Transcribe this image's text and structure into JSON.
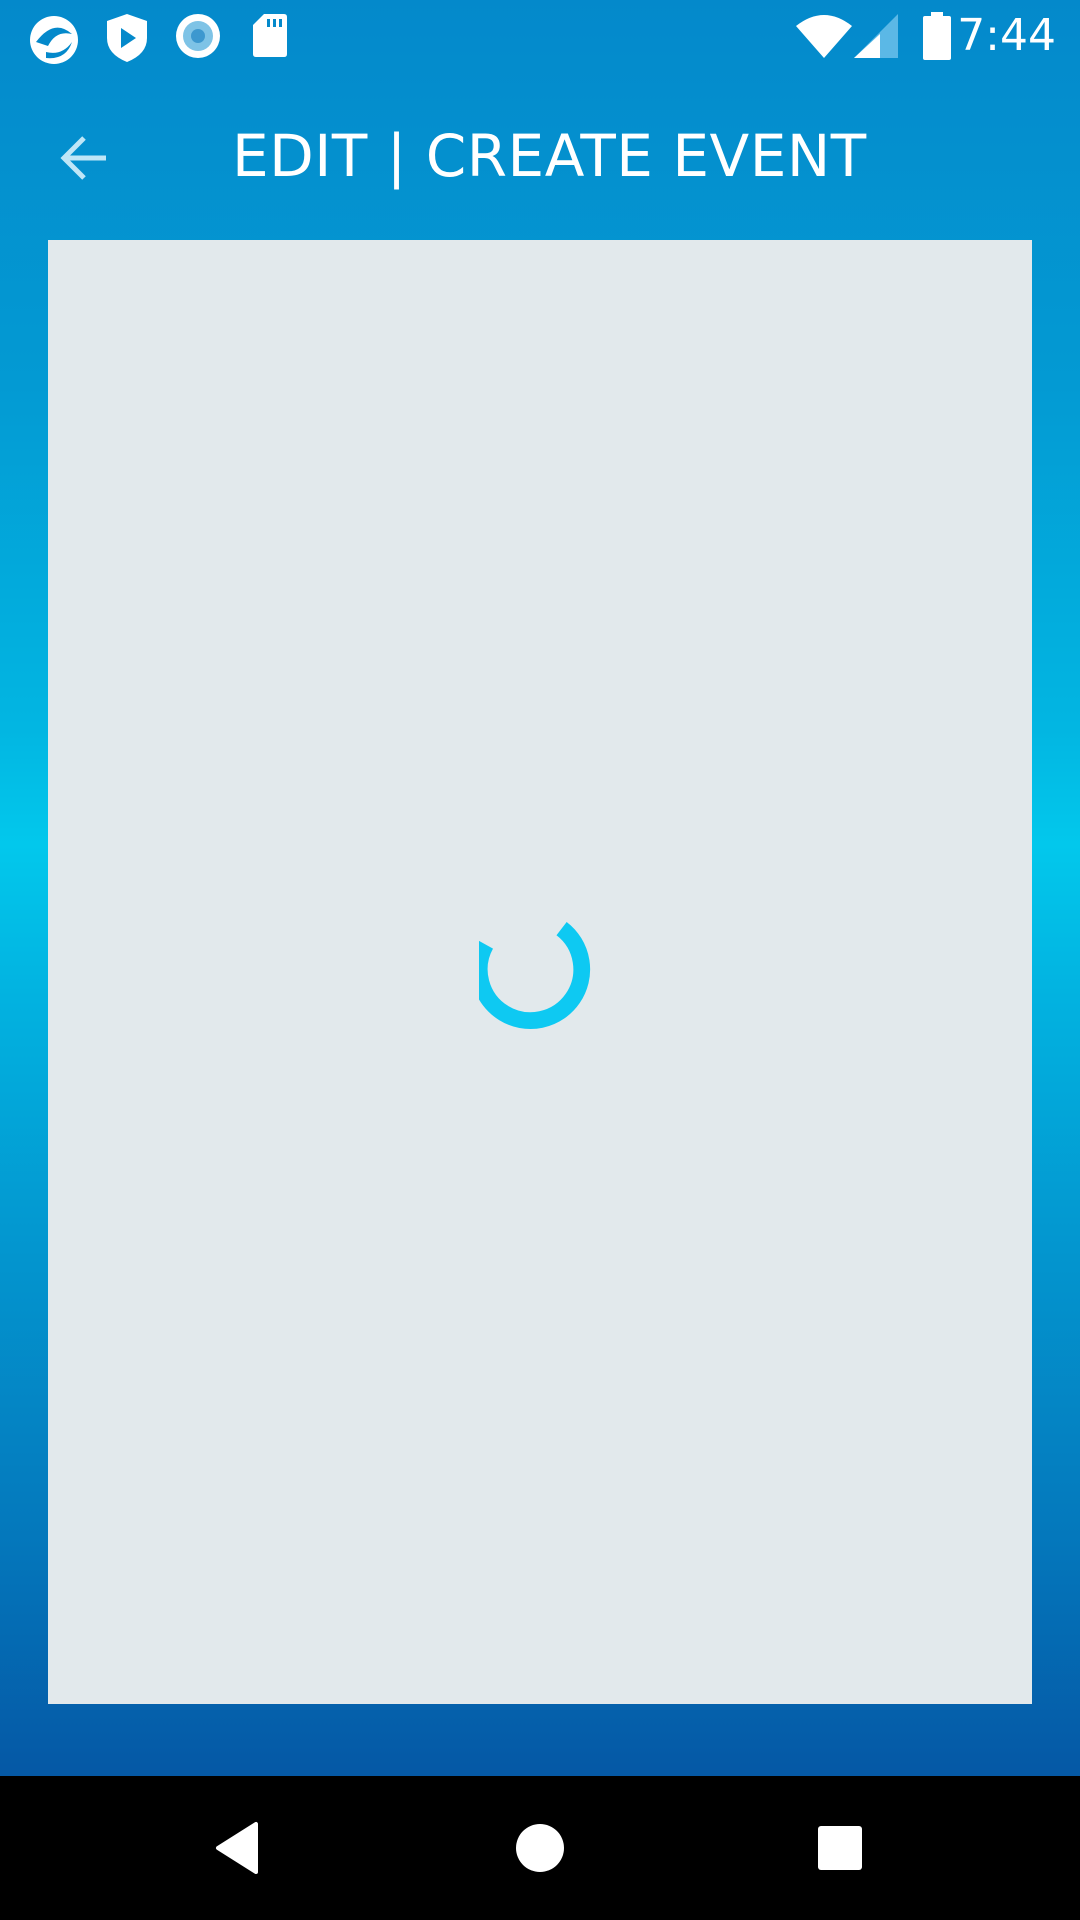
{
  "status_bar": {
    "time": "7:44",
    "notification_icons": [
      "app-logo-icon",
      "shield-play-icon",
      "record-icon",
      "sd-card-icon"
    ],
    "system_icons": [
      "wifi-icon",
      "cell-signal-icon",
      "battery-icon"
    ]
  },
  "app_bar": {
    "title": "EDIT | CREATE EVENT",
    "back_icon": "arrow-left-icon"
  },
  "content": {
    "state": "loading"
  },
  "nav_bar": {
    "buttons": [
      "back-triangle-icon",
      "home-circle-icon",
      "recents-square-icon"
    ]
  },
  "colors": {
    "accent_spinner": "#0ec9f2",
    "card_background": "#e2e9ec",
    "top_gradient": "#0489cb",
    "mid_gradient": "#02c8ec",
    "bottom_gradient": "#0559a6"
  }
}
